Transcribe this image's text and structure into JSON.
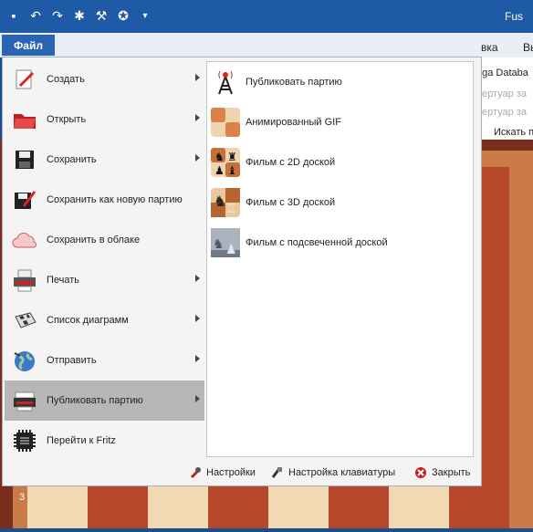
{
  "titlebar": {
    "title": "Fus"
  },
  "quick_access": [
    "save-icon",
    "undo-icon",
    "redo-icon",
    "bug-icon",
    "tools-icon",
    "bulb-icon",
    "dropdown-icon"
  ],
  "ribbon": {
    "file_tab": "Файл",
    "tab_partial_1": "вка",
    "tab_partial_2": "Вы"
  },
  "background_panel": {
    "db": "ega Databa",
    "line2": "пертуар за",
    "line3": "пертуар за",
    "search": "Искать п"
  },
  "board": {
    "rank_label": "3"
  },
  "menu": {
    "items": [
      {
        "label": "Создать",
        "icon": "create-icon",
        "submenu": true
      },
      {
        "label": "Открыть",
        "icon": "open-folder-icon",
        "submenu": true
      },
      {
        "label": "Сохранить",
        "icon": "save-icon",
        "submenu": true
      },
      {
        "label": "Сохранить как новую партию",
        "icon": "save-new-icon",
        "submenu": false
      },
      {
        "label": "Сохранить в облаке",
        "icon": "cloud-icon",
        "submenu": false
      },
      {
        "label": "Печать",
        "icon": "printer-icon",
        "submenu": true
      },
      {
        "label": "Список диаграмм",
        "icon": "diagram-list-icon",
        "submenu": true
      },
      {
        "label": "Отправить",
        "icon": "globe-icon",
        "submenu": true
      },
      {
        "label": "Публиковать партию",
        "icon": "publish-icon",
        "submenu": true,
        "selected": true
      },
      {
        "label": "Перейти к Fritz",
        "icon": "fritz-chip-icon",
        "submenu": false
      }
    ],
    "submenu": [
      {
        "label": "Публиковать партию",
        "icon": "antenna-icon"
      },
      {
        "label": "Анимированный GIF",
        "icon": "gif-board-icon"
      },
      {
        "label": "Фильм с 2D доской",
        "icon": "board-2d-icon"
      },
      {
        "label": "Фильм с 3D доской",
        "icon": "board-3d-icon"
      },
      {
        "label": "Фильм с подсвеченной доской",
        "icon": "lit-board-icon"
      }
    ],
    "footer": {
      "settings": "Настройки",
      "keyboard": "Настройка клавиатуры",
      "close": "Закрыть"
    }
  }
}
